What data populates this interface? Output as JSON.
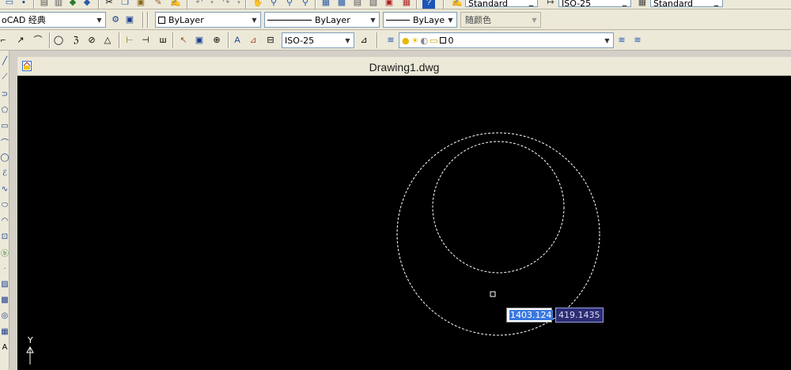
{
  "toolbar_top": {
    "text_style_value": "Standard",
    "dim_style_value": "ISO-25",
    "table_style_value": "Standard"
  },
  "toolbar_properties": {
    "workspace_value": "oCAD 经典",
    "color_value": "ByLayer",
    "linetype_value": "ByLayer",
    "lineweight_value": "ByLayer",
    "plotstyle_value": "随颜色"
  },
  "toolbar_dimension": {
    "dim_style_value": "ISO-25",
    "layer_value": "0"
  },
  "drawing": {
    "title": "Drawing1.dwg",
    "ucs_y_label": "Y",
    "coord_x": "1403.124",
    "coord_y": "419.1435"
  },
  "colors": {
    "canvas_bg": "#000000",
    "coord_x_highlight": "#3a78e0",
    "coord_y_bg": "#2c2d73"
  }
}
